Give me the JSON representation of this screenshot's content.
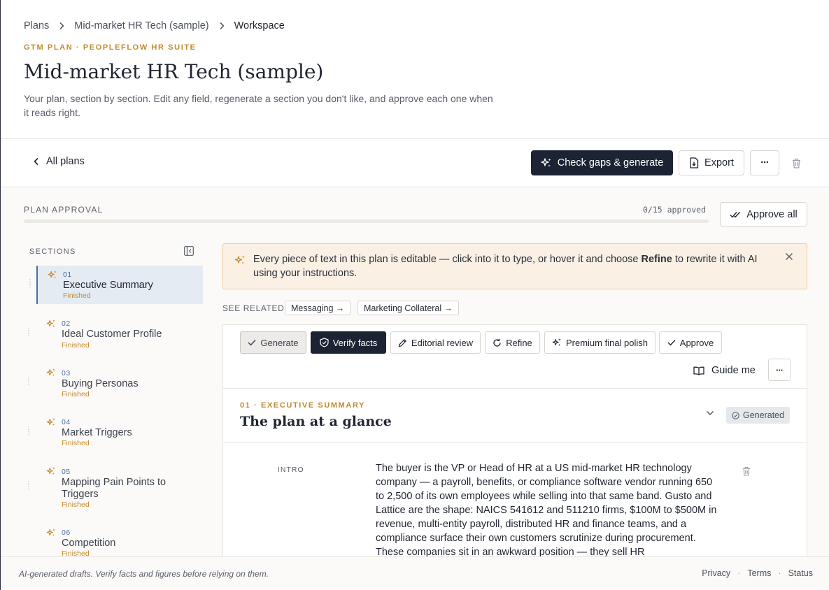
{
  "breadcrumb": {
    "plans": "Plans",
    "market": "Mid-market HR Tech (sample)",
    "current": "Workspace"
  },
  "header": {
    "kicker": "GTM PLAN · PEOPLEFLOW HR SUITE",
    "title": "Mid-market HR Tech (sample)",
    "subtitle": "Your plan, section by section. Edit any field, regenerate a section you don't like, and approve each one when it reads right."
  },
  "toolbar": {
    "back_label": "All plans",
    "check_gaps_label": "Check gaps & generate",
    "export_label": "Export",
    "more_label": "···"
  },
  "approval": {
    "label": "PLAN APPROVAL",
    "count": "0/15 approved",
    "progress": 0,
    "approve_all_label": "Approve all"
  },
  "sidebar": {
    "label": "SECTIONS",
    "items": [
      {
        "num": "01",
        "title": "Executive Summary",
        "status": "Finished"
      },
      {
        "num": "02",
        "title": "Ideal Customer Profile",
        "status": "Finished"
      },
      {
        "num": "03",
        "title": "Buying Personas",
        "status": "Finished"
      },
      {
        "num": "04",
        "title": "Market Triggers",
        "status": "Finished"
      },
      {
        "num": "05",
        "title": "Mapping Pain Points to Triggers",
        "status": "Finished"
      },
      {
        "num": "06",
        "title": "Competition",
        "status": "Finished"
      }
    ]
  },
  "notice": {
    "text_before": "Every piece of text in this plan is editable — click into it to type, or hover it and choose ",
    "text_bold": "Refine",
    "text_after": " to rewrite it with AI using your instructions."
  },
  "related": {
    "label": "SEE RELATED",
    "items": [
      "Messaging →",
      "Marketing Collateral →"
    ]
  },
  "card": {
    "buttons": {
      "generate": "Generate",
      "verify": "Verify facts",
      "editorial": "Editorial review",
      "refine": "Refine",
      "polish": "Premium final polish",
      "approve": "Approve"
    },
    "guide_label": "Guide me",
    "more_label": "···",
    "section_kicker": "01 · EXECUTIVE SUMMARY",
    "section_heading": "The plan at a glance",
    "badge": "Generated",
    "intro_label": "INTRO",
    "body": "The buyer is the VP or Head of HR at a US mid-market HR technology company — a payroll, benefits, or compliance software vendor running 650 to 2,500 of its own employees while selling into that same band. Gusto and Lattice are the shape: NAICS 541612 and 511210 firms, $100M to $500M in revenue, multi-entity payroll, distributed HR and finance teams, and a compliance surface their own customers scrutinize during procurement. These companies sit in an awkward position — they sell HR"
  },
  "footer": {
    "disclaimer": "AI-generated drafts. Verify facts and figures before relying on them.",
    "privacy": "Privacy",
    "terms": "Terms",
    "status": "Status",
    "dot": "·"
  },
  "colors": {
    "accent_gold": "#c38a2c",
    "dark": "#1c2333",
    "link_blue": "#4a6fa5",
    "notice_bg": "#fbf0e4"
  }
}
